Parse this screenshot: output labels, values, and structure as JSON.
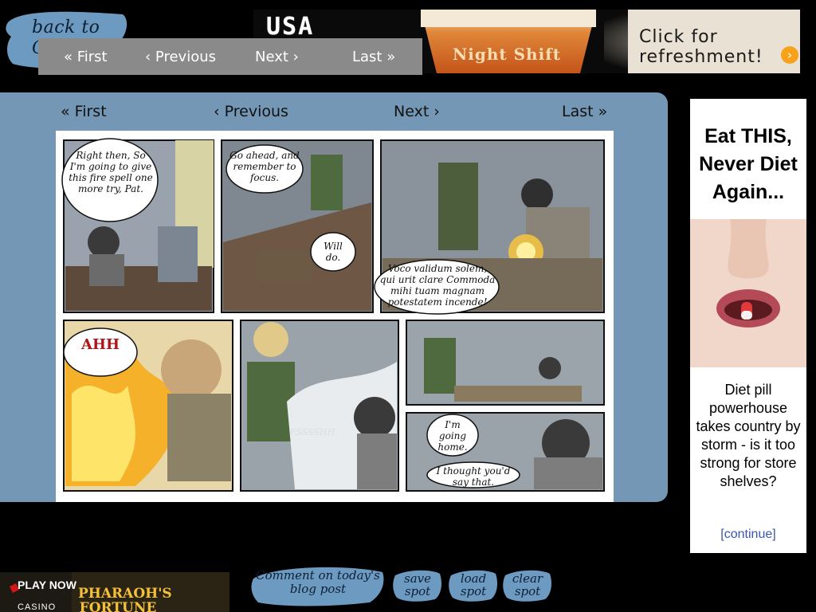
{
  "header": {
    "back_label": "back to Comics"
  },
  "top_nav": {
    "first": "« First",
    "previous": "‹ Previous",
    "next": "Next ›",
    "last": "Last »"
  },
  "banner_ad": {
    "brand_text": "USA",
    "product": "Night Shift",
    "cta_line1": "Click for",
    "cta_line2": "refreshment!",
    "arrow": "›"
  },
  "comic_nav": {
    "first": "« First",
    "previous": "‹ Previous",
    "next": "Next ›",
    "last": "Last »"
  },
  "comic": {
    "panel1_text": "Right then, So I'm going to give this fire spell one more try, Pat.",
    "panel2_text_a": "Go ahead, and remember to focus.",
    "panel2_text_b": "Will do.",
    "panel3_text": "Voco validum solem, qui urit clare Commoda mihi tuam magnam potestatem incende!",
    "panel4_text": "AHH",
    "panel5_text": "FSSSSHH",
    "panel7_text_a": "I'm going home.",
    "panel7_text_b": "I thought you'd say that."
  },
  "side_ad": {
    "headline": "Eat THIS, Never Diet Again...",
    "body": "Diet pill powerhouse takes country by storm - is it too strong for store shelves?",
    "continue": "[continue]"
  },
  "casino_ad": {
    "play_now": "PLAY NOW",
    "casino": "CASINO",
    "game_title": "PHARAOH'S FORTUNE"
  },
  "bottom_buttons": {
    "comment": "Comment on today's blog post",
    "save": "save spot",
    "load": "load spot",
    "clear": "clear spot"
  },
  "colors": {
    "background": "#000000",
    "comic_card": "#7397b4",
    "nav_bar": "#8a8a8a",
    "brush": "#6d9ac0"
  }
}
